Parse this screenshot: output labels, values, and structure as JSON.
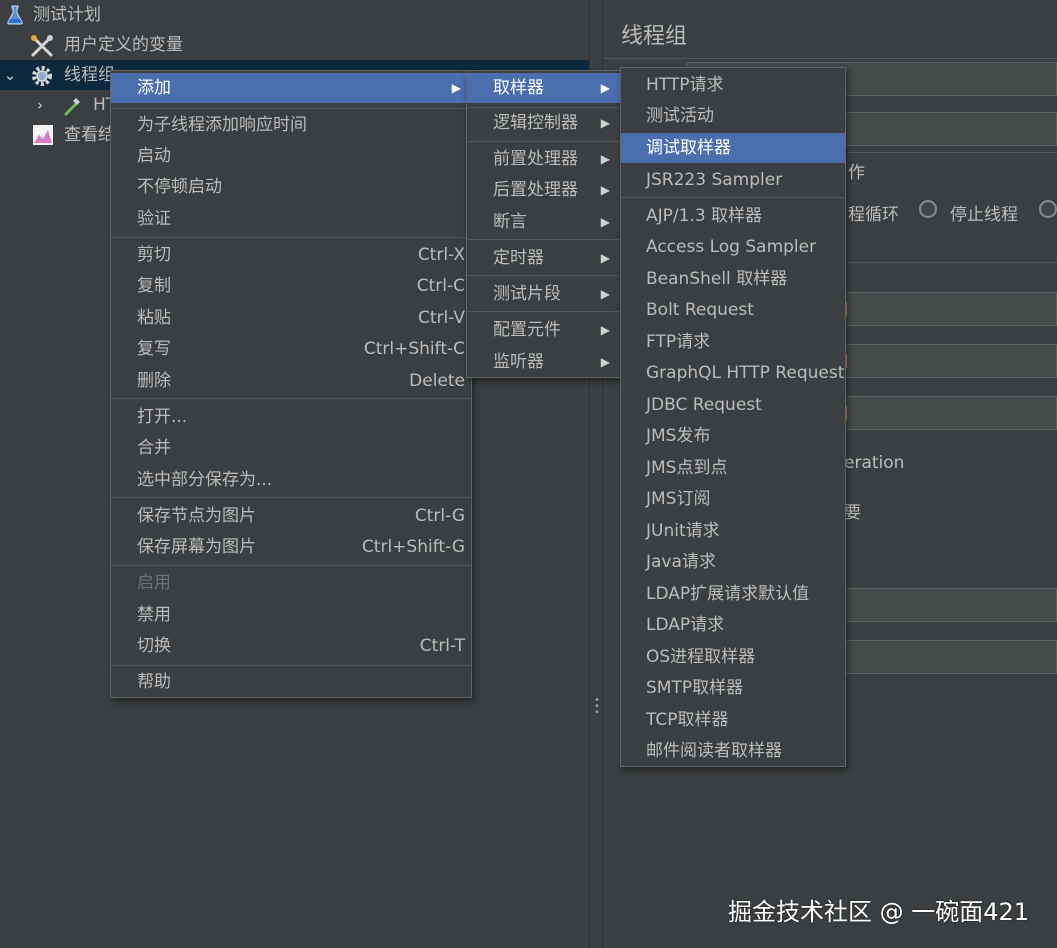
{
  "tree": {
    "items": [
      {
        "label": "测试计划",
        "icon": "flask-icon"
      },
      {
        "label": "用户定义的变量",
        "icon": "wrench-icon"
      },
      {
        "label": "线程组",
        "icon": "gear-icon"
      },
      {
        "label": "HT",
        "icon": "dropper-icon"
      },
      {
        "label": "查看结",
        "icon": "graph-icon"
      }
    ]
  },
  "panel": {
    "title": "线程组",
    "partial_texts": {
      "action_suffix": "作",
      "loop_text": "程循环",
      "stop_thread": "停止线程",
      "iteration": "eration",
      "fragment": "要"
    }
  },
  "context_menu": {
    "items": [
      {
        "label": "添加",
        "shortcut": "",
        "submenu": true,
        "state": "active"
      },
      {
        "label": "为子线程添加响应时间",
        "shortcut": ""
      },
      {
        "label": "启动",
        "shortcut": ""
      },
      {
        "label": "不停顿启动",
        "shortcut": ""
      },
      {
        "label": "验证",
        "shortcut": ""
      },
      {
        "label": "剪切",
        "shortcut": "Ctrl-X"
      },
      {
        "label": "复制",
        "shortcut": "Ctrl-C"
      },
      {
        "label": "粘贴",
        "shortcut": "Ctrl-V"
      },
      {
        "label": "复写",
        "shortcut": "Ctrl+Shift-C"
      },
      {
        "label": "删除",
        "shortcut": "Delete"
      },
      {
        "label": "打开...",
        "shortcut": ""
      },
      {
        "label": "合并",
        "shortcut": ""
      },
      {
        "label": "选中部分保存为...",
        "shortcut": ""
      },
      {
        "label": "保存节点为图片",
        "shortcut": "Ctrl-G"
      },
      {
        "label": "保存屏幕为图片",
        "shortcut": "Ctrl+Shift-G"
      },
      {
        "label": "启用",
        "shortcut": "",
        "state": "disabled"
      },
      {
        "label": "禁用",
        "shortcut": ""
      },
      {
        "label": "切换",
        "shortcut": "Ctrl-T"
      },
      {
        "label": "帮助",
        "shortcut": ""
      }
    ]
  },
  "add_submenu": {
    "items": [
      {
        "label": "取样器",
        "state": "active"
      },
      {
        "label": "逻辑控制器"
      },
      {
        "label": "前置处理器"
      },
      {
        "label": "后置处理器"
      },
      {
        "label": "断言"
      },
      {
        "label": "定时器"
      },
      {
        "label": "测试片段"
      },
      {
        "label": "配置元件"
      },
      {
        "label": "监听器"
      }
    ]
  },
  "sampler_submenu": {
    "items": [
      {
        "label": "HTTP请求"
      },
      {
        "label": "测试活动"
      },
      {
        "label": "调试取样器",
        "state": "active"
      },
      {
        "label": "JSR223 Sampler"
      },
      {
        "label": "AJP/1.3 取样器"
      },
      {
        "label": "Access Log Sampler"
      },
      {
        "label": "BeanShell 取样器"
      },
      {
        "label": "Bolt Request"
      },
      {
        "label": "FTP请求"
      },
      {
        "label": "GraphQL HTTP Request"
      },
      {
        "label": "JDBC Request"
      },
      {
        "label": "JMS发布"
      },
      {
        "label": "JMS点到点"
      },
      {
        "label": "JMS订阅"
      },
      {
        "label": "JUnit请求"
      },
      {
        "label": "Java请求"
      },
      {
        "label": "LDAP扩展请求默认值"
      },
      {
        "label": "LDAP请求"
      },
      {
        "label": "OS进程取样器"
      },
      {
        "label": "SMTP取样器"
      },
      {
        "label": "TCP取样器"
      },
      {
        "label": "邮件阅读者取样器"
      }
    ]
  },
  "watermark": "掘金技术社区 @ 一碗面421",
  "colors": {
    "background": "#3c3f41",
    "menu_highlight": "#4b6eaf",
    "text": "#bbbbbb",
    "disabled": "#6e7174"
  }
}
